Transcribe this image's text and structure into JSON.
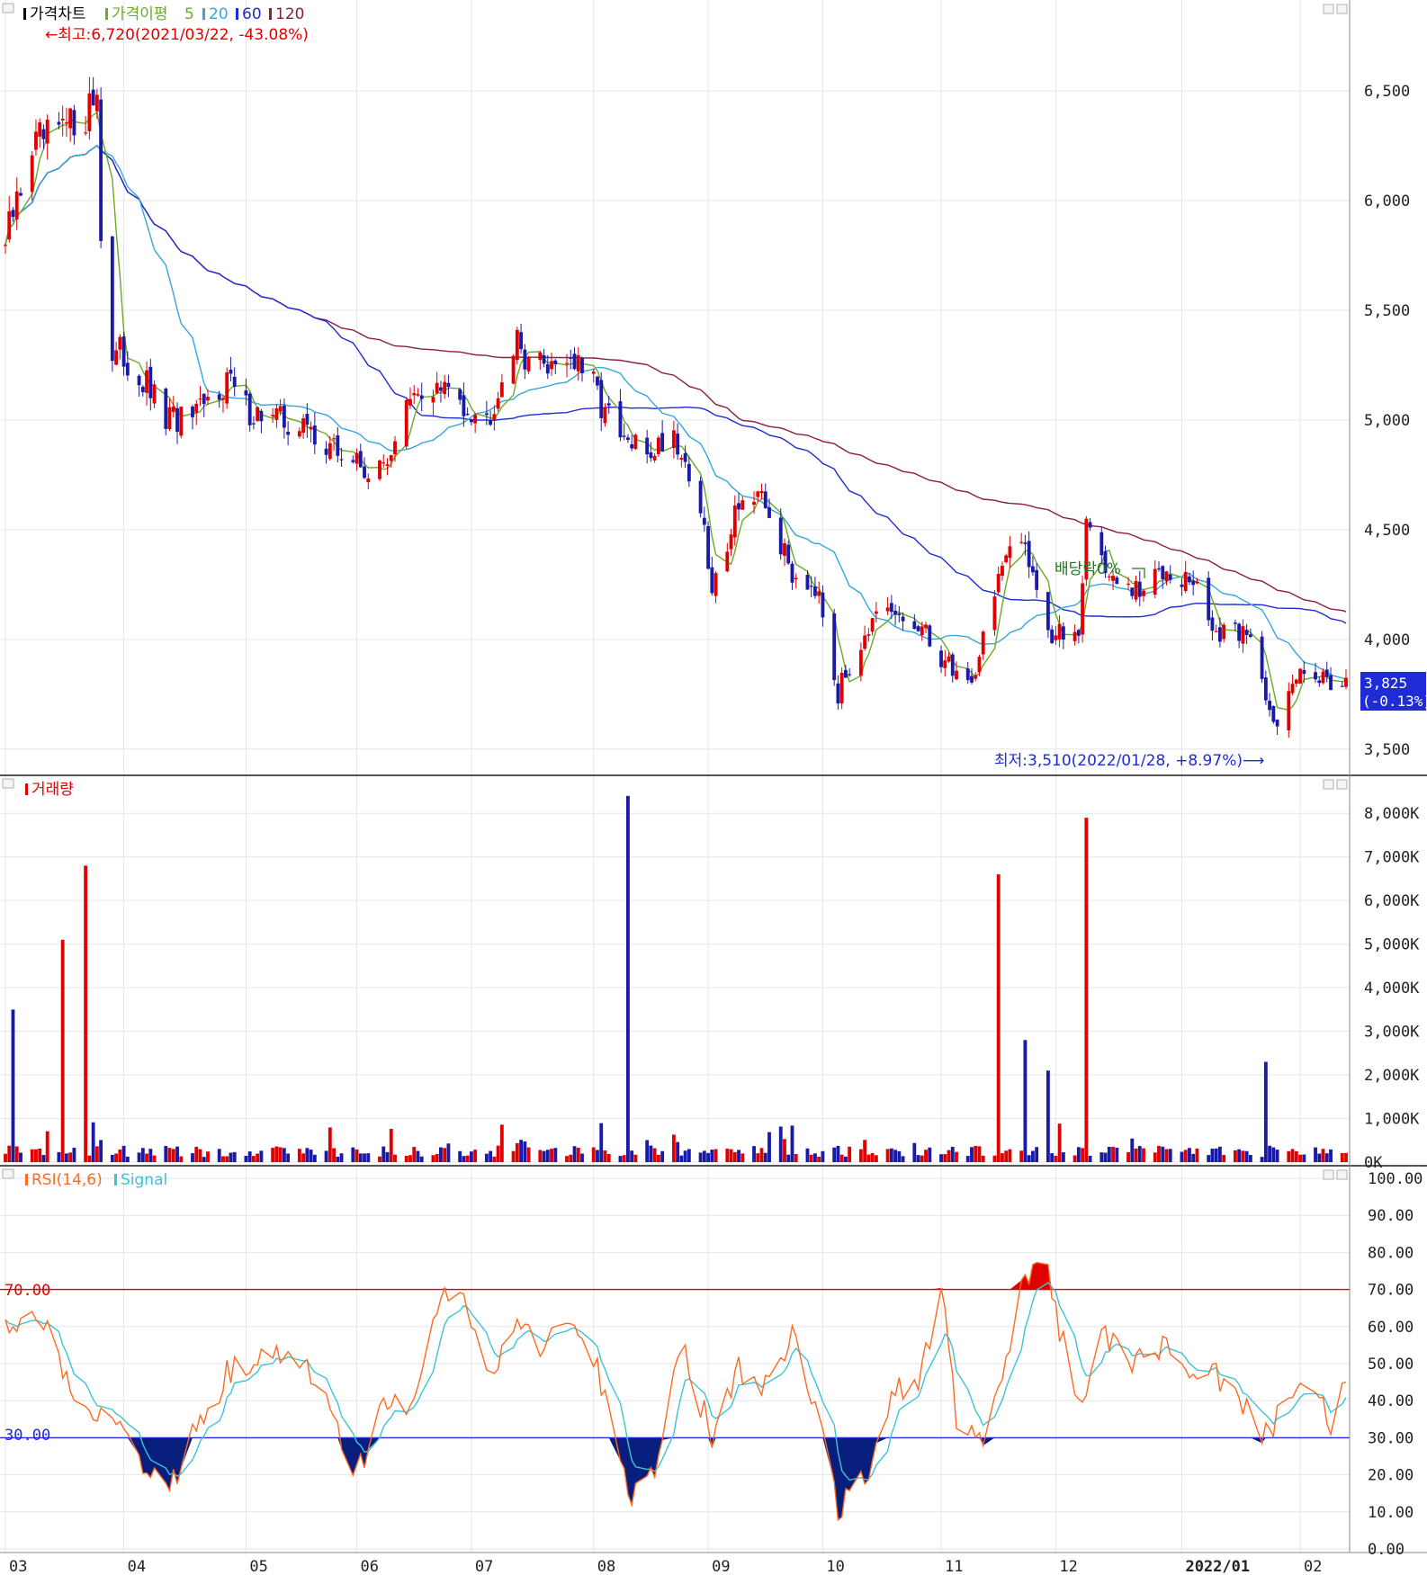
{
  "colors": {
    "up": "#e10000",
    "down": "#1a1aa8",
    "ma5": "#6aab25",
    "ma20": "#35a6e0",
    "ma60": "#1f2bd6",
    "ma120": "#8a1d43",
    "rsi": "#ff6a22",
    "signal": "#3cc4d6",
    "rsi_fill": "#071e7c",
    "rsi_upper_line": "#e10000",
    "rsi_lower_line": "#1f2bd6",
    "current_price_bg": "#1f2bd6"
  },
  "price_panel": {
    "legend": {
      "title": "가격차트",
      "ma_label": "가격이평",
      "ma5": "5",
      "ma20": "20",
      "ma60": "60",
      "ma120": "120"
    },
    "max_annotation": "←최고:6,720(2021/03/22, -43.08%)",
    "min_annotation": "최저:3,510(2022/01/28, +8.97%)⟶",
    "dividend_annotation": "배당락0%",
    "current_price": "3,825",
    "current_change": "(-0.13%)",
    "y_ticks": [
      "6,500",
      "6,000",
      "5,500",
      "5,000",
      "4,500",
      "4,000",
      "3,500"
    ]
  },
  "volume_panel": {
    "legend": {
      "title": "거래량"
    },
    "y_ticks": [
      "8,000K",
      "7,000K",
      "6,000K",
      "5,000K",
      "4,000K",
      "3,000K",
      "2,000K",
      "1,000K",
      "0K"
    ]
  },
  "rsi_panel": {
    "legend": {
      "rsi": "RSI(14,6)",
      "signal": "Signal"
    },
    "upper_label": "70.00",
    "lower_label": "30.00",
    "y_ticks": [
      "100.00",
      "90.00",
      "80.00",
      "70.00",
      "60.00",
      "50.00",
      "40.00",
      "30.00",
      "20.00",
      "10.00",
      "0.00"
    ]
  },
  "x_axis": {
    "labels": [
      "03",
      "04",
      "05",
      "06",
      "07",
      "08",
      "09",
      "10",
      "11",
      "12",
      "2022/01",
      "02"
    ]
  },
  "chart_data": [
    {
      "type": "candlestick",
      "period": "2021/03 - 2022/02 (daily)",
      "ylim": [
        3450,
        6750
      ],
      "high": {
        "value": 6720,
        "date": "2021/03/22"
      },
      "low": {
        "value": 3510,
        "date": "2022/01/28"
      },
      "last_close": 3825,
      "last_change_pct": -0.13,
      "close_path": [
        {
          "x": "2021-03-01",
          "y": 5800
        },
        {
          "x": "2021-03-08",
          "y": 6250
        },
        {
          "x": "2021-03-15",
          "y": 6300
        },
        {
          "x": "2021-03-22",
          "y": 6400
        },
        {
          "x": "2021-03-25",
          "y": 6500
        },
        {
          "x": "2021-03-27",
          "y": 5250
        },
        {
          "x": "2021-03-31",
          "y": 5300
        },
        {
          "x": "2021-04-07",
          "y": 5150
        },
        {
          "x": "2021-04-12",
          "y": 5000
        },
        {
          "x": "2021-04-20",
          "y": 5000
        },
        {
          "x": "2021-04-28",
          "y": 5200
        },
        {
          "x": "2021-05-03",
          "y": 5050
        },
        {
          "x": "2021-05-12",
          "y": 5000
        },
        {
          "x": "2021-05-20",
          "y": 4950
        },
        {
          "x": "2021-05-27",
          "y": 4850
        },
        {
          "x": "2021-06-07",
          "y": 4750
        },
        {
          "x": "2021-06-14",
          "y": 5050
        },
        {
          "x": "2021-06-21",
          "y": 5150
        },
        {
          "x": "2021-06-28",
          "y": 5100
        },
        {
          "x": "2021-07-05",
          "y": 5000
        },
        {
          "x": "2021-07-12",
          "y": 5350
        },
        {
          "x": "2021-07-19",
          "y": 5250
        },
        {
          "x": "2021-07-26",
          "y": 5300
        },
        {
          "x": "2021-08-02",
          "y": 5150
        },
        {
          "x": "2021-08-09",
          "y": 4900
        },
        {
          "x": "2021-08-16",
          "y": 4850
        },
        {
          "x": "2021-08-23",
          "y": 4950
        },
        {
          "x": "2021-08-30",
          "y": 4600
        },
        {
          "x": "2021-09-02",
          "y": 4200
        },
        {
          "x": "2021-09-09",
          "y": 4650
        },
        {
          "x": "2021-09-16",
          "y": 4600
        },
        {
          "x": "2021-09-23",
          "y": 4300
        },
        {
          "x": "2021-09-30",
          "y": 4250
        },
        {
          "x": "2021-10-05",
          "y": 3750
        },
        {
          "x": "2021-10-12",
          "y": 4050
        },
        {
          "x": "2021-10-19",
          "y": 4100
        },
        {
          "x": "2021-10-26",
          "y": 4050
        },
        {
          "x": "2021-11-02",
          "y": 3900
        },
        {
          "x": "2021-11-09",
          "y": 3800
        },
        {
          "x": "2021-11-16",
          "y": 4300
        },
        {
          "x": "2021-11-23",
          "y": 4450
        },
        {
          "x": "2021-11-30",
          "y": 4000
        },
        {
          "x": "2021-12-07",
          "y": 4050
        },
        {
          "x": "2021-12-09",
          "y": 4550
        },
        {
          "x": "2021-12-16",
          "y": 4250
        },
        {
          "x": "2021-12-23",
          "y": 4200
        },
        {
          "x": "2021-12-30",
          "y": 4350
        },
        {
          "x": "2022-01-06",
          "y": 4250
        },
        {
          "x": "2022-01-13",
          "y": 4000
        },
        {
          "x": "2022-01-20",
          "y": 4050
        },
        {
          "x": "2022-01-28",
          "y": 3600
        },
        {
          "x": "2022-02-04",
          "y": 3900
        },
        {
          "x": "2022-02-11",
          "y": 3800
        },
        {
          "x": "2022-02-15",
          "y": 3825
        }
      ],
      "series": [
        {
          "name": "5",
          "type": "line"
        },
        {
          "name": "20",
          "type": "line"
        },
        {
          "name": "60",
          "type": "line"
        },
        {
          "name": "120",
          "type": "line"
        }
      ]
    },
    {
      "type": "bar",
      "ylim": [
        0,
        8500
      ],
      "peaks": [
        {
          "x": "2021-03-03",
          "y": 3500
        },
        {
          "x": "2021-03-16",
          "y": 5100
        },
        {
          "x": "2021-03-22",
          "y": 6800
        },
        {
          "x": "2021-08-11",
          "y": 8400
        },
        {
          "x": "2021-11-16",
          "y": 6600
        },
        {
          "x": "2021-11-23",
          "y": 2800
        },
        {
          "x": "2021-11-29",
          "y": 2100
        },
        {
          "x": "2021-12-09",
          "y": 7900
        },
        {
          "x": "2022-01-25",
          "y": 2300
        }
      ]
    },
    {
      "type": "line",
      "ylim": [
        0,
        100
      ],
      "thresholds": [
        70,
        30
      ],
      "series": [
        {
          "name": "RSI(14,6)",
          "points": [
            {
              "x": "2021-03-01",
              "y": 60
            },
            {
              "x": "2021-03-10",
              "y": 63
            },
            {
              "x": "2021-03-20",
              "y": 40
            },
            {
              "x": "2021-03-31",
              "y": 33
            },
            {
              "x": "2021-04-06",
              "y": 24
            },
            {
              "x": "2021-04-12",
              "y": 14
            },
            {
              "x": "2021-04-19",
              "y": 30
            },
            {
              "x": "2021-04-28",
              "y": 47
            },
            {
              "x": "2021-05-07",
              "y": 53
            },
            {
              "x": "2021-05-14",
              "y": 50
            },
            {
              "x": "2021-05-21",
              "y": 47
            },
            {
              "x": "2021-05-27",
              "y": 35
            },
            {
              "x": "2021-05-31",
              "y": 17
            },
            {
              "x": "2021-06-07",
              "y": 37
            },
            {
              "x": "2021-06-15",
              "y": 40
            },
            {
              "x": "2021-06-21",
              "y": 60
            },
            {
              "x": "2021-06-25",
              "y": 70
            },
            {
              "x": "2021-06-30",
              "y": 67
            },
            {
              "x": "2021-07-05",
              "y": 45
            },
            {
              "x": "2021-07-12",
              "y": 60
            },
            {
              "x": "2021-07-19",
              "y": 55
            },
            {
              "x": "2021-07-26",
              "y": 62
            },
            {
              "x": "2021-08-02",
              "y": 50
            },
            {
              "x": "2021-08-06",
              "y": 40
            },
            {
              "x": "2021-08-11",
              "y": 14
            },
            {
              "x": "2021-08-18",
              "y": 20
            },
            {
              "x": "2021-08-25",
              "y": 55
            },
            {
              "x": "2021-09-02",
              "y": 30
            },
            {
              "x": "2021-09-09",
              "y": 48
            },
            {
              "x": "2021-09-16",
              "y": 45
            },
            {
              "x": "2021-09-24",
              "y": 58
            },
            {
              "x": "2021-09-30",
              "y": 35
            },
            {
              "x": "2021-10-05",
              "y": 11
            },
            {
              "x": "2021-10-12",
              "y": 18
            },
            {
              "x": "2021-10-19",
              "y": 42
            },
            {
              "x": "2021-10-26",
              "y": 45
            },
            {
              "x": "2021-11-01",
              "y": 70
            },
            {
              "x": "2021-11-05",
              "y": 35
            },
            {
              "x": "2021-11-12",
              "y": 27
            },
            {
              "x": "2021-11-19",
              "y": 55
            },
            {
              "x": "2021-11-23",
              "y": 73
            },
            {
              "x": "2021-11-29",
              "y": 77
            },
            {
              "x": "2021-12-01",
              "y": 63
            },
            {
              "x": "2021-12-07",
              "y": 40
            },
            {
              "x": "2021-12-14",
              "y": 58
            },
            {
              "x": "2021-12-21",
              "y": 50
            },
            {
              "x": "2021-12-29",
              "y": 55
            },
            {
              "x": "2022-01-05",
              "y": 45
            },
            {
              "x": "2022-01-12",
              "y": 47
            },
            {
              "x": "2022-01-19",
              "y": 40
            },
            {
              "x": "2022-01-25",
              "y": 30
            },
            {
              "x": "2022-02-03",
              "y": 48
            },
            {
              "x": "2022-02-09",
              "y": 38
            },
            {
              "x": "2022-02-11",
              "y": 27
            },
            {
              "x": "2022-02-15",
              "y": 48
            }
          ]
        },
        {
          "name": "Signal"
        }
      ]
    }
  ]
}
